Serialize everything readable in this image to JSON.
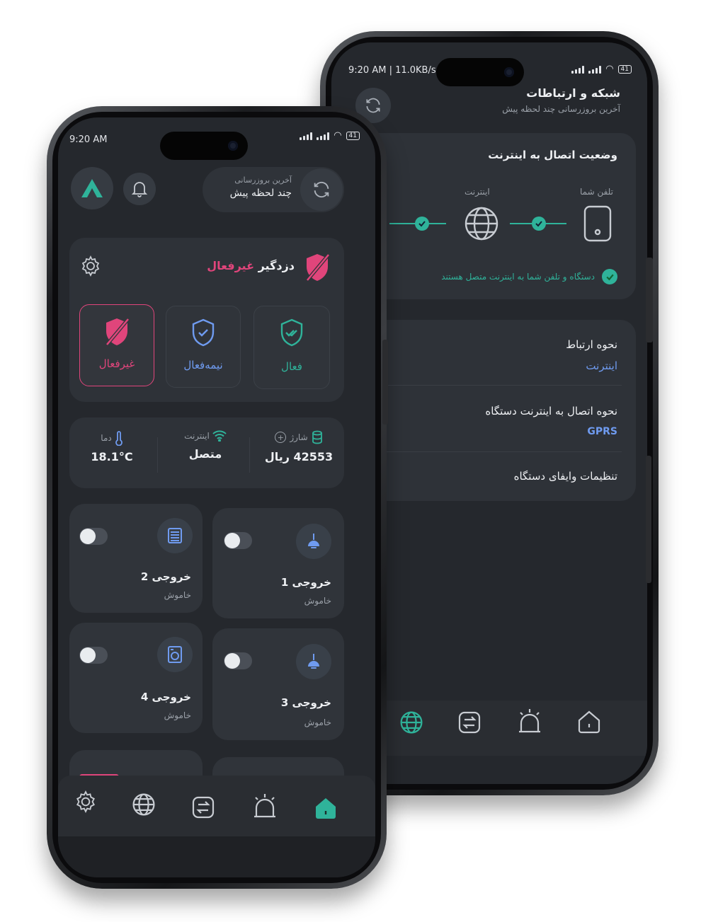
{
  "back_phone": {
    "status": {
      "time": "9:20 AM | 11.0KB/s",
      "battery": "41"
    },
    "header": {
      "title": "شبکه و ارتباطات",
      "subtitle": "آخرین بروزرسانی چند لحظه پیش"
    },
    "connection_card": {
      "title": "وضعیت اتصال به اینترنت",
      "phone_label": "تلفن شما",
      "internet_label": "اینترنت",
      "status_message": "دستگاه و تلفن شما به اینترنت متصل هستند"
    },
    "settings": [
      {
        "label": "نحوه ارتباط",
        "value": "اینترنت"
      },
      {
        "label": "نحوه اتصال به اینترنت دستگاه",
        "value": "GPRS"
      },
      {
        "label": "تنظیمات وایفای دستگاه",
        "value": ""
      }
    ],
    "nav": [
      "globe-icon",
      "transfer-icon",
      "alarm-icon",
      "home-icon"
    ]
  },
  "front_phone": {
    "status": {
      "time": "9:20 AM",
      "battery": "41"
    },
    "header": {
      "update_label": "آخرین بروزرسانی",
      "update_value": "چند لحظه پیش"
    },
    "alarm": {
      "title": "دزدگیر",
      "state": "غیرفعال",
      "modes": [
        {
          "label": "غیرفعال",
          "selected": true
        },
        {
          "label": "نیمه‌فعال",
          "selected": false
        },
        {
          "label": "فعال",
          "selected": false
        }
      ]
    },
    "stats": {
      "temp_label": "دما",
      "temp_value": "18.1°C",
      "internet_label": "اینترنت",
      "internet_value": "متصل",
      "charge_label": "شارژ",
      "charge_value": "42553 ریال"
    },
    "outputs": [
      {
        "name": "خروجی 1",
        "state": "خاموش"
      },
      {
        "name": "خروجی 2",
        "state": "خاموش"
      },
      {
        "name": "خروجی 3",
        "state": "خاموش"
      },
      {
        "name": "خروجی 4",
        "state": "خاموش"
      }
    ],
    "nav": [
      "gear-icon",
      "globe-icon",
      "transfer-icon",
      "alarm-icon",
      "home-icon"
    ]
  },
  "colors": {
    "accent_teal": "#2fb39a",
    "accent_pink": "#e0457b",
    "accent_blue": "#6f9bf0",
    "background": "#25282d"
  }
}
